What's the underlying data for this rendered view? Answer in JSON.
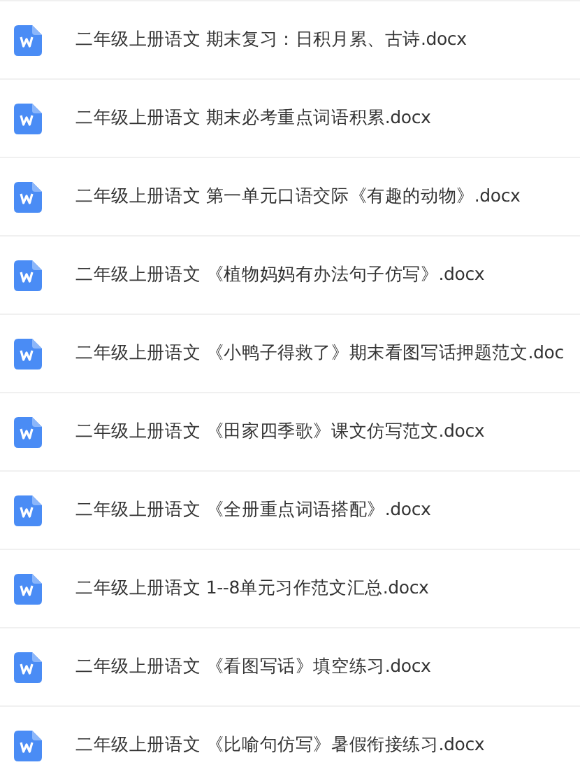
{
  "files": [
    {
      "name": "二年级上册语文 期末复习：日积月累、古诗.docx"
    },
    {
      "name": "二年级上册语文 期末必考重点词语积累.docx"
    },
    {
      "name": "二年级上册语文 第一单元口语交际《有趣的动物》.docx"
    },
    {
      "name": "二年级上册语文 《植物妈妈有办法句子仿写》.docx"
    },
    {
      "name": "二年级上册语文 《小鸭子得救了》期末看图写话押题范文.doc"
    },
    {
      "name": "二年级上册语文 《田家四季歌》课文仿写范文.docx"
    },
    {
      "name": "二年级上册语文 《全册重点词语搭配》.docx"
    },
    {
      "name": "二年级上册语文 1--8单元习作范文汇总.docx"
    },
    {
      "name": "二年级上册语文 《看图写话》填空练习.docx"
    },
    {
      "name": "二年级上册语文 《比喻句仿写》暑假衔接练习.docx"
    }
  ]
}
